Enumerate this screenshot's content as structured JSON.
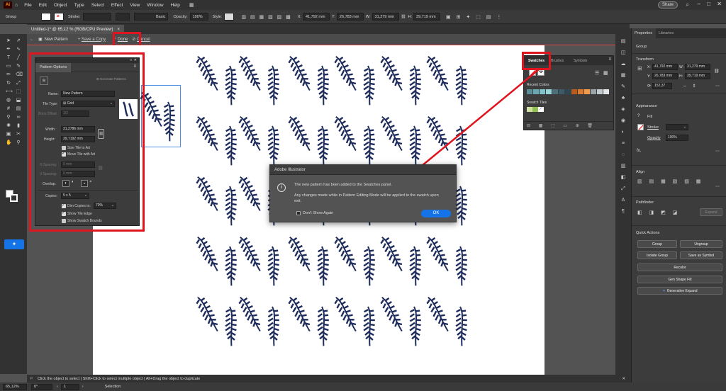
{
  "app": {
    "logo": "Ai"
  },
  "menu": {
    "items": [
      "File",
      "Edit",
      "Object",
      "Type",
      "Select",
      "Effect",
      "View",
      "Window",
      "Help"
    ],
    "share": "Share"
  },
  "control": {
    "selection": "Group",
    "stroke_label": "Stroke:",
    "brush": "Basic",
    "opacity_label": "Opacity:",
    "opacity": "100%",
    "style_label": "Style:",
    "x_label": "X:",
    "x": "41,792 mm",
    "y_label": "Y:",
    "y": "26,783 mm",
    "w_label": "W:",
    "w": "31,279 mm",
    "h_label": "H:",
    "h": "39,719 mm"
  },
  "doc": {
    "tab": "Untitled-1* @ 65,12 % (RGB/CPU Preview)",
    "close": "×"
  },
  "pattern_bar": {
    "new_pattern": "New Pattern",
    "save_copy": "Save a Copy",
    "done": "Done",
    "cancel": "Cancel"
  },
  "pattern_options": {
    "title": "Pattern Options",
    "generate": "Generate Patterns",
    "name_label": "Name:",
    "name": "New Pattern",
    "tile_type_label": "Tile Type:",
    "tile_type": "Grid",
    "brick_offset_label": "Brick Offset:",
    "brick_offset": "1/2",
    "width_label": "Width:",
    "width": "31,2786 mm",
    "height_label": "Height:",
    "height": "39,7192 mm",
    "size_tile": "Size Tile to Art",
    "move_tile": "Move Tile with Art",
    "h_spacing_label": "H Spacing:",
    "h_spacing": "0 mm",
    "v_spacing_label": "V Spacing:",
    "v_spacing": "0 mm",
    "overlap_label": "Overlap:",
    "copies_label": "Copies:",
    "copies": "5 x 5",
    "dim_copies": "Dim Copies to:",
    "dim_value": "70%",
    "show_tile_edge": "Show Tile Edge",
    "show_swatch_bounds": "Show Swatch Bounds"
  },
  "swatches": {
    "tabs": [
      "Swatches",
      "Brushes",
      "Symbols"
    ],
    "recent_label": "Recent Colors",
    "tiles_label": "Swatch Tiles",
    "recent": [
      "#5a8f9a",
      "#6aa7b0",
      "#7fc4c9",
      "#99d5d8",
      "#4c6f7c",
      "#3e5a68",
      "#2f4653",
      "#b85b1f",
      "#e07a2b",
      "#f29b4b",
      "#9aa4aa",
      "#c3cbce",
      "#e3e7e9"
    ]
  },
  "dialog": {
    "title": "Adobe Illustrator",
    "line1": "The new pattern has been added to the Swatches panel.",
    "line2": "Any changes made while in Pattern Editing Mode will be applied to the swatch upon exit.",
    "dont_show": "Don't Show Again",
    "ok": "OK"
  },
  "properties": {
    "tabs": [
      "Properties",
      "Libraries"
    ],
    "group": "Group",
    "transform": "Transform",
    "x_label": "X:",
    "x": "41,792 mm",
    "y_label": "Y:",
    "y": "26,783 mm",
    "w_label": "W:",
    "w": "31,279 mm",
    "h_label": "H:",
    "h": "39,719 mm",
    "angle": "152,37",
    "appearance": "Appearance",
    "fill": "Fill",
    "stroke": "Stroke",
    "opacity": "Opacity",
    "opacity_value": "100%",
    "fx": "fx.",
    "align": "Align",
    "pathfinder": "Pathfinder",
    "expand": "Expand",
    "quick_actions": "Quick Actions",
    "q_group": "Group",
    "q_ungroup": "Ungroup",
    "q_isolate": "Isolate Group",
    "q_save_symbol": "Save as Symbol",
    "q_recolor": "Recolor",
    "q_gen_shape": "Gen Shape Fill",
    "q_gen_expand": "Generative Expand"
  },
  "hint": {
    "text": "Click the object to select   |   Shift+Click to select multiple object   |   Alt+Drag the object to duplicate"
  },
  "status": {
    "zoom": "65,12%",
    "rotation": "0°",
    "artboard": "1",
    "tool": "Selection"
  }
}
